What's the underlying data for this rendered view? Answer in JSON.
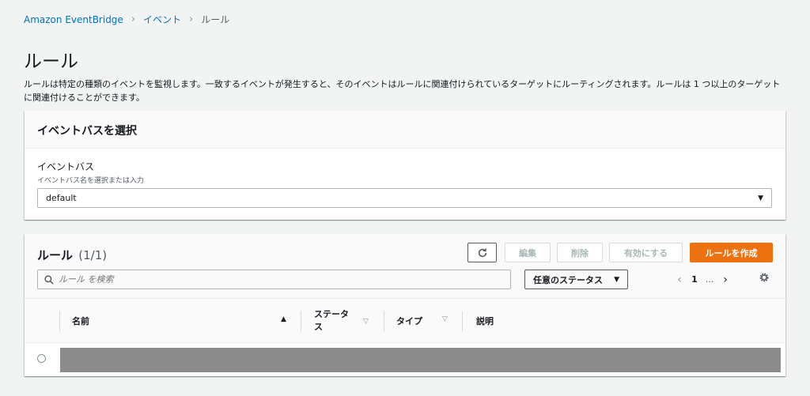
{
  "breadcrumb": {
    "items": [
      "Amazon EventBridge",
      "イベント"
    ],
    "current": "ルール"
  },
  "page": {
    "title": "ルール",
    "description": "ルールは特定の種類のイベントを監視します。一致するイベントが発生すると、そのイベントはルールに関連付けられているターゲットにルーティングされます。ルールは 1 つ以上のターゲットに関連付けることができます。"
  },
  "event_bus": {
    "header": "イベントバスを選択",
    "label": "イベントバス",
    "description": "イベントバス名を選択または入力",
    "value": "default"
  },
  "rules": {
    "title": "ルール",
    "count": "(1/1)",
    "buttons": {
      "edit": "編集",
      "delete": "削除",
      "enable": "有効にする",
      "create": "ルールを作成"
    },
    "search_placeholder": "ルール を検索",
    "status_filter": "任意のステータス",
    "pagination": {
      "current": "1",
      "ellipsis": "..."
    },
    "columns": {
      "name": "名前",
      "status": "ステータス",
      "type": "タイプ",
      "description": "説明"
    }
  },
  "colors": {
    "primary": "#ec7211",
    "link": "#0073bb"
  }
}
